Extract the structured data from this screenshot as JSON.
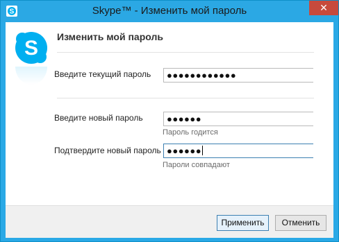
{
  "window": {
    "title": "Skype™ - Изменить мой пароль",
    "close_glyph": "✕",
    "accent_color": "#2ba8e4"
  },
  "icons": {
    "app": "skype-icon",
    "logo": "skype-logo-icon",
    "close": "close-icon"
  },
  "header": {
    "title": "Изменить мой пароль"
  },
  "fields": {
    "current": {
      "label": "Введите текущий пароль",
      "value": "●●●●●●●●●●●●"
    },
    "new": {
      "label": "Введите новый пароль",
      "value": "●●●●●●",
      "hint": "Пароль годится"
    },
    "confirm": {
      "label": "Подтвердите новый пароль",
      "value": "●●●●●●",
      "hint": "Пароли совпадают"
    }
  },
  "buttons": {
    "apply": "Применить",
    "cancel": "Отменить"
  }
}
